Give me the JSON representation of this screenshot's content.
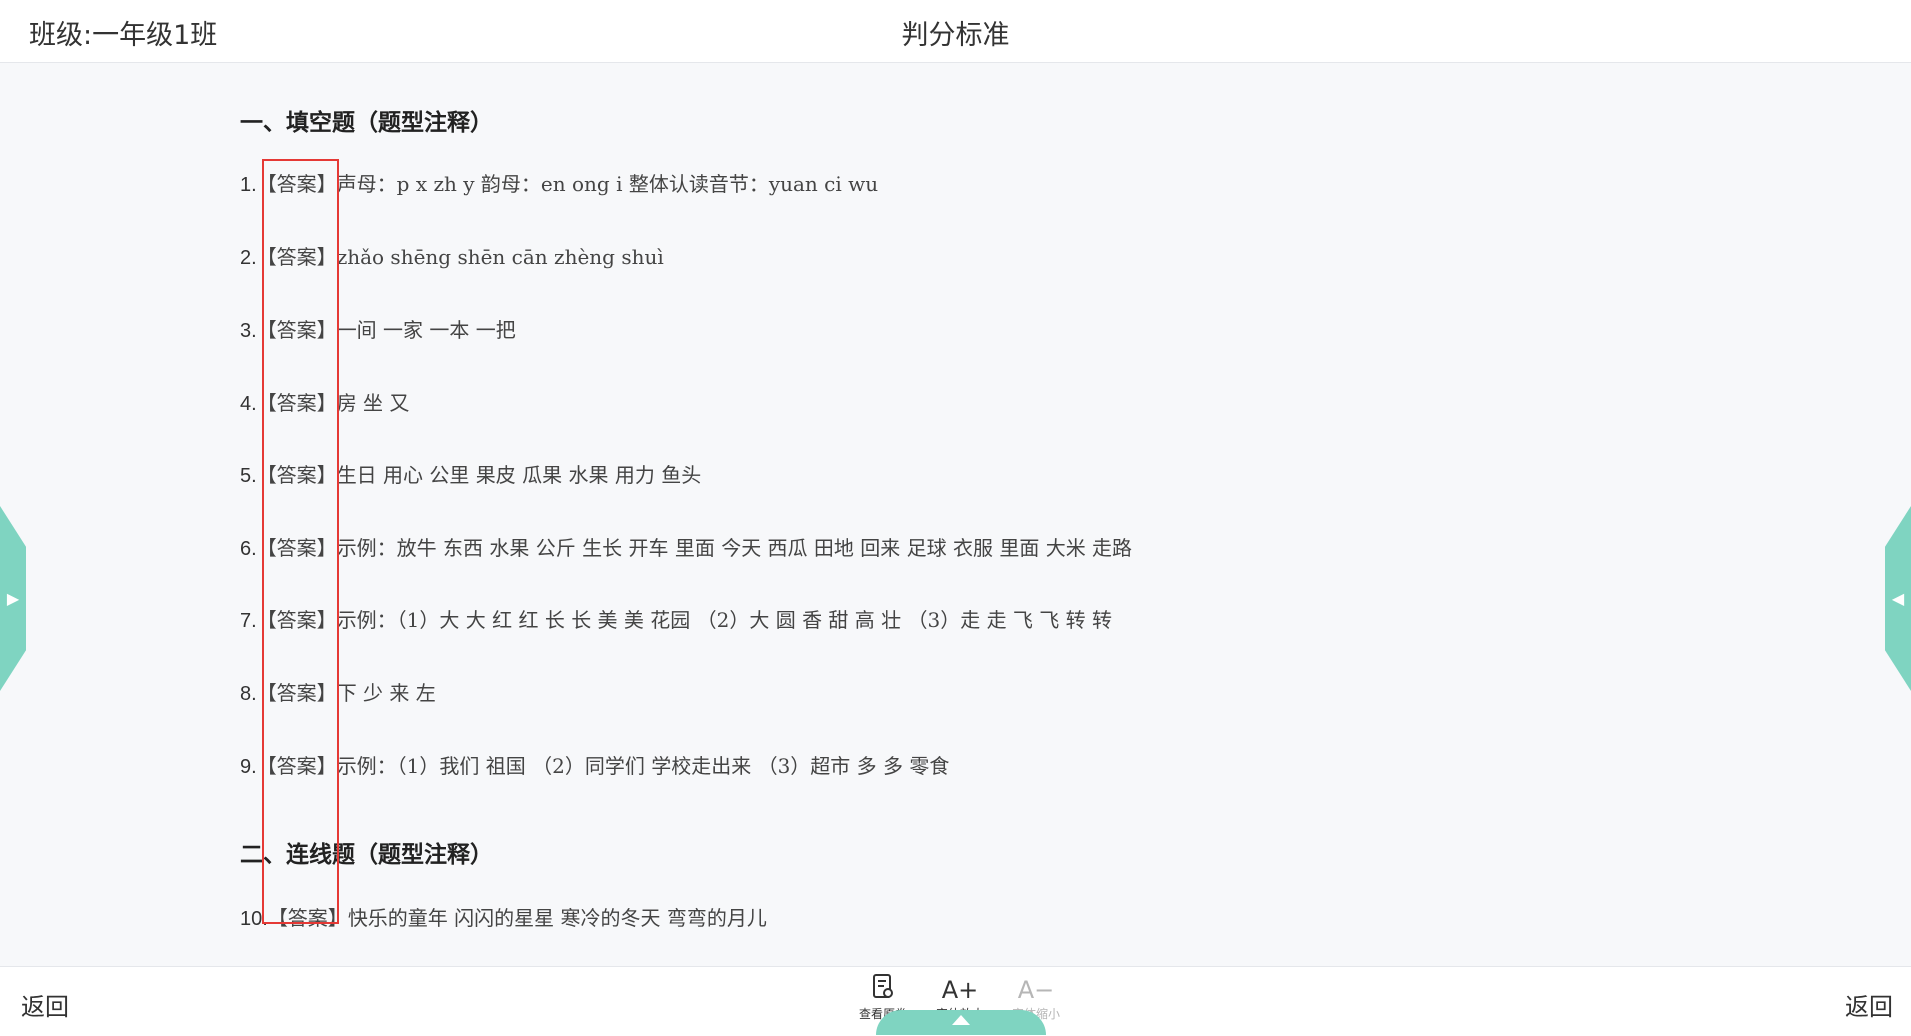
{
  "header": {
    "class_label": "班级:一年级1班",
    "title": "判分标准"
  },
  "sections": [
    {
      "title": "一、填空题（题型注释）",
      "items": [
        {
          "num": "1.",
          "tag": "【答案】",
          "text": "声母：p  x  zh  y   韵母：en  ong  i   整体认读音节：yuan  ci  wu"
        },
        {
          "num": "2.",
          "tag": "【答案】",
          "text": "zhǎo   shēng   shēn   cān   zhèng   shuì"
        },
        {
          "num": "3.",
          "tag": "【答案】",
          "text": "一间    一家    一本    一把"
        },
        {
          "num": "4.",
          "tag": "【答案】",
          "text": "房    坐    又"
        },
        {
          "num": "5.",
          "tag": "【答案】",
          "text": "生日    用心    公里    果皮    瓜果    水果    用力    鱼头"
        },
        {
          "num": "6.",
          "tag": "【答案】",
          "text": "示例：放牛    东西    水果    公斤    生长    开车    里面    今天    西瓜    田地    回来    足球    衣服    里面    大米    走路"
        },
        {
          "num": "7.",
          "tag": "【答案】",
          "text": "示例：（1）大    大    红    红    长    长    美    美    花园    （2）大    圆    香    甜    高    壮    （3）走    走    飞    飞    转    转"
        },
        {
          "num": "8.",
          "tag": "【答案】",
          "text": "下    少    来    左"
        },
        {
          "num": "9.",
          "tag": "【答案】",
          "text": "示例：（1）我们    祖国    （2）同学们    学校走出来    （3）超市    多    多    零食"
        }
      ]
    },
    {
      "title": "二、连线题（题型注释）",
      "items": [
        {
          "num": "10.",
          "tag": "【答案】",
          "text": "快乐的童年    闪闪的星星    寒冷的冬天    弯弯的月儿"
        }
      ]
    }
  ],
  "toolbar": {
    "back_left": "返回",
    "back_right": "返回",
    "view_original_label": "查看原卷",
    "zoom_in_label": "字体放大",
    "zoom_out_label": "字体缩小",
    "zoom_in_icon": "A+",
    "zoom_out_icon": "A−"
  },
  "colors": {
    "accent": "#7fd4c1",
    "highlight_box": "#e53935"
  },
  "icons": {
    "view_original": "document-check-icon",
    "zoom_in": "font-increase-icon",
    "zoom_out": "font-decrease-icon",
    "left_tab": "triangle-right-icon",
    "right_tab": "triangle-left-icon",
    "bottom_handle": "triangle-up-icon"
  }
}
